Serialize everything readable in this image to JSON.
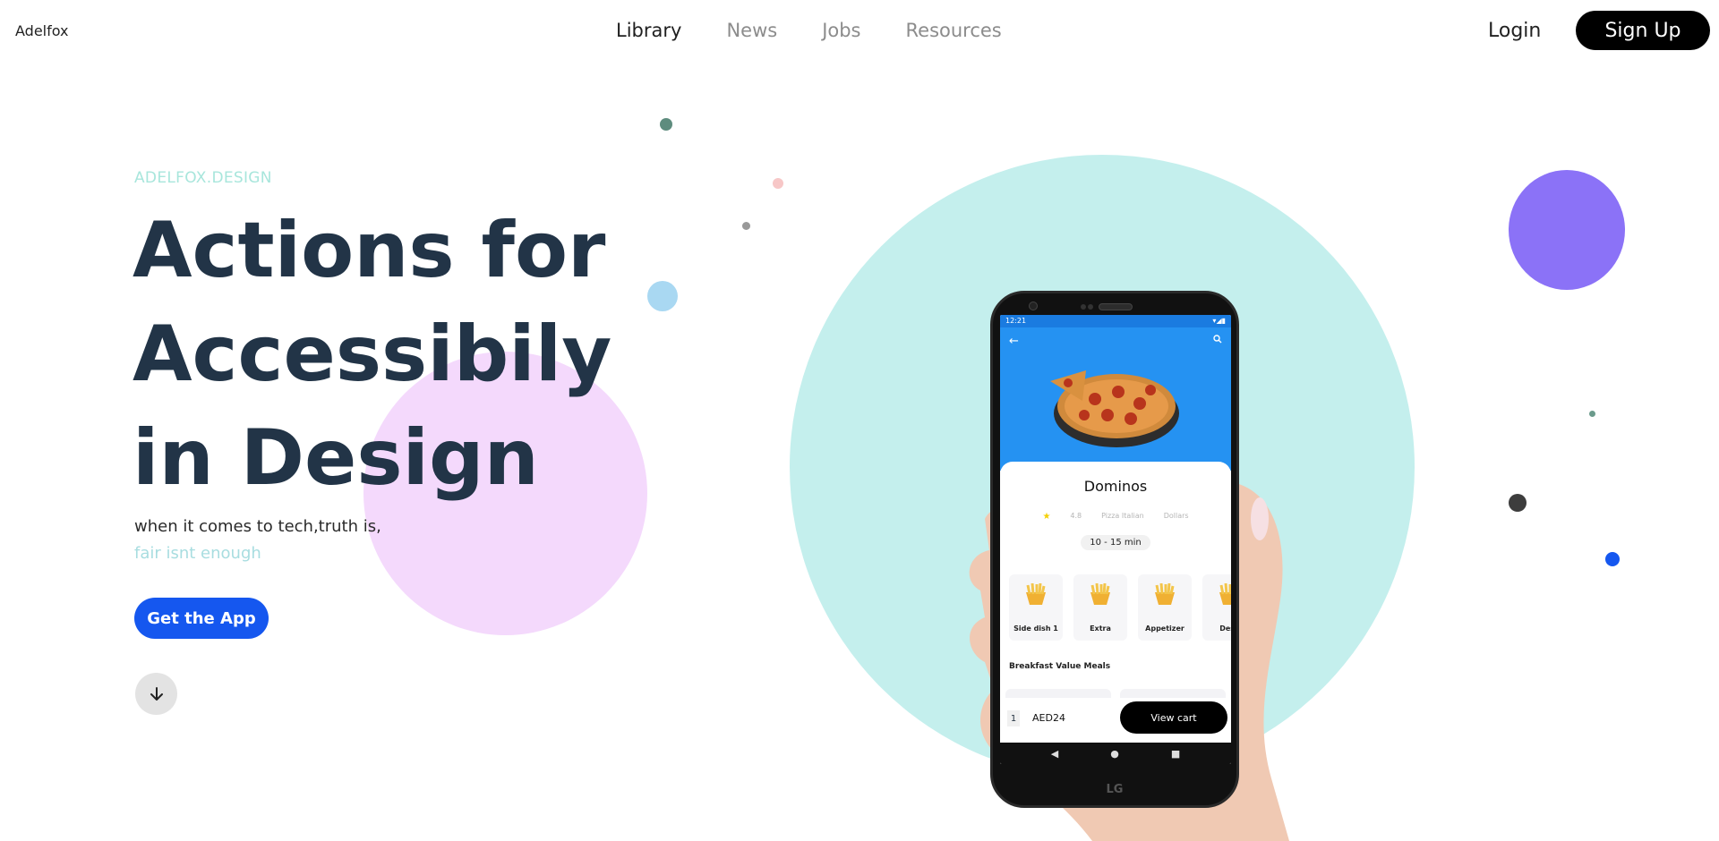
{
  "header": {
    "logo": "Adelfox",
    "nav": [
      "Library",
      "News",
      "Jobs",
      "Resources"
    ],
    "active_nav": "Library",
    "login": "Login",
    "signup": "Sign Up"
  },
  "hero": {
    "eyebrow": "ADELFOX.DESIGN",
    "headline": [
      "Actions for",
      "Accessibily",
      "in Design"
    ],
    "subline1": "when it comes to tech,truth is,",
    "subline2": "fair isnt enough",
    "cta": "Get the App"
  },
  "colors": {
    "accent_blue": "#1557ef",
    "teal_circle": "#c4efed",
    "pink_circle": "#f4d9fc",
    "purple_circle": "#8b72f7",
    "headline": "#223447"
  },
  "phone": {
    "brand": "LG",
    "status": {
      "time": "12:21"
    },
    "restaurant": "Dominos",
    "rating": "4.8",
    "cuisine": "Pizza Italian",
    "price_level": "Dollars",
    "eta": "10 - 15 min",
    "categories": [
      "Side dish 1",
      "Extra",
      "Appetizer",
      "Dess"
    ],
    "section_title": "Breakfast Value Meals",
    "cart": {
      "quantity": "1",
      "price": "AED24",
      "button": "View cart"
    }
  },
  "icons": {
    "back": "arrow-left-icon",
    "search": "search-icon",
    "scroll": "arrow-down-icon"
  }
}
